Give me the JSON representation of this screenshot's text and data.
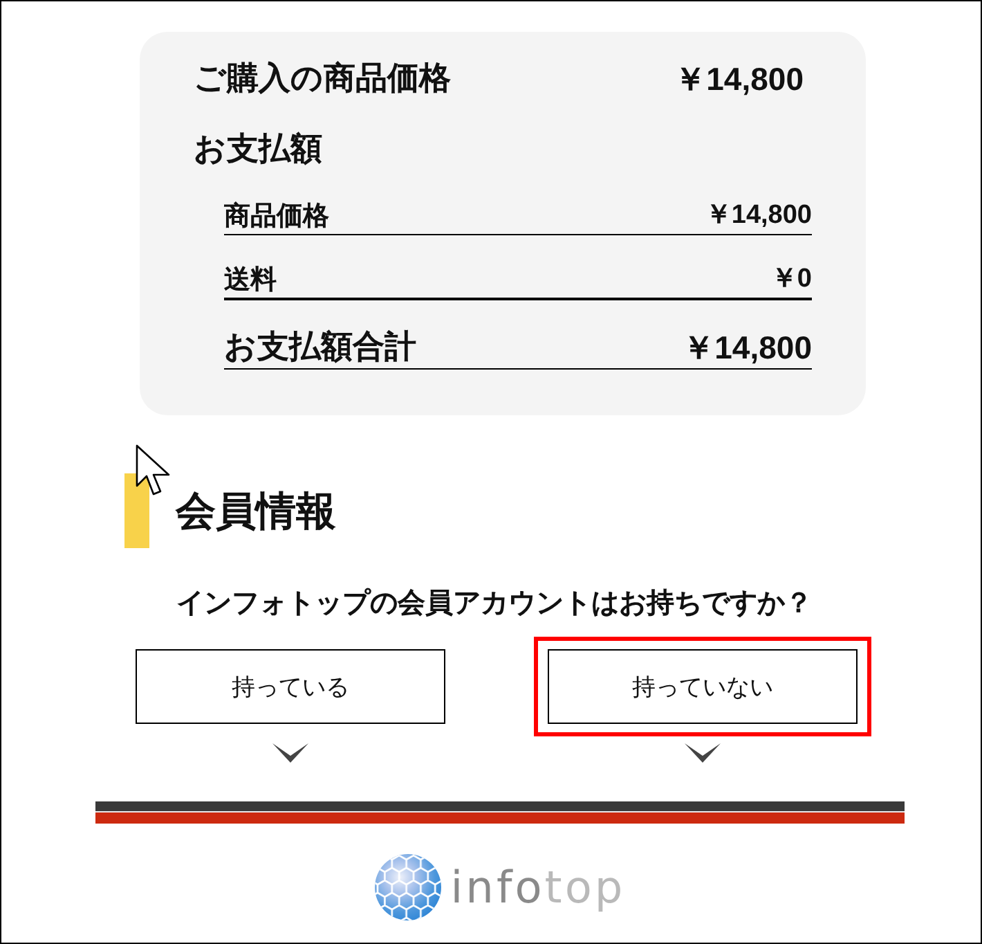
{
  "summary": {
    "purchase": {
      "label": "ご購入の商品価格",
      "value": "￥14,800"
    },
    "payment_heading": "お支払額",
    "lines": [
      {
        "kind": "item",
        "label": "商品価格",
        "value": "￥14,800"
      },
      {
        "kind": "item",
        "label": "送料",
        "value": "￥0"
      },
      {
        "kind": "total",
        "label": "お支払額合計",
        "value": "￥14,800"
      }
    ]
  },
  "section": {
    "title": "会員情報",
    "question": "インフォトップの会員アカウントはお持ちですか？",
    "options": [
      {
        "label": "持っている",
        "highlighted": false
      },
      {
        "label": "持っていない",
        "highlighted": true
      }
    ]
  },
  "footer": {
    "logo": "infotop"
  }
}
